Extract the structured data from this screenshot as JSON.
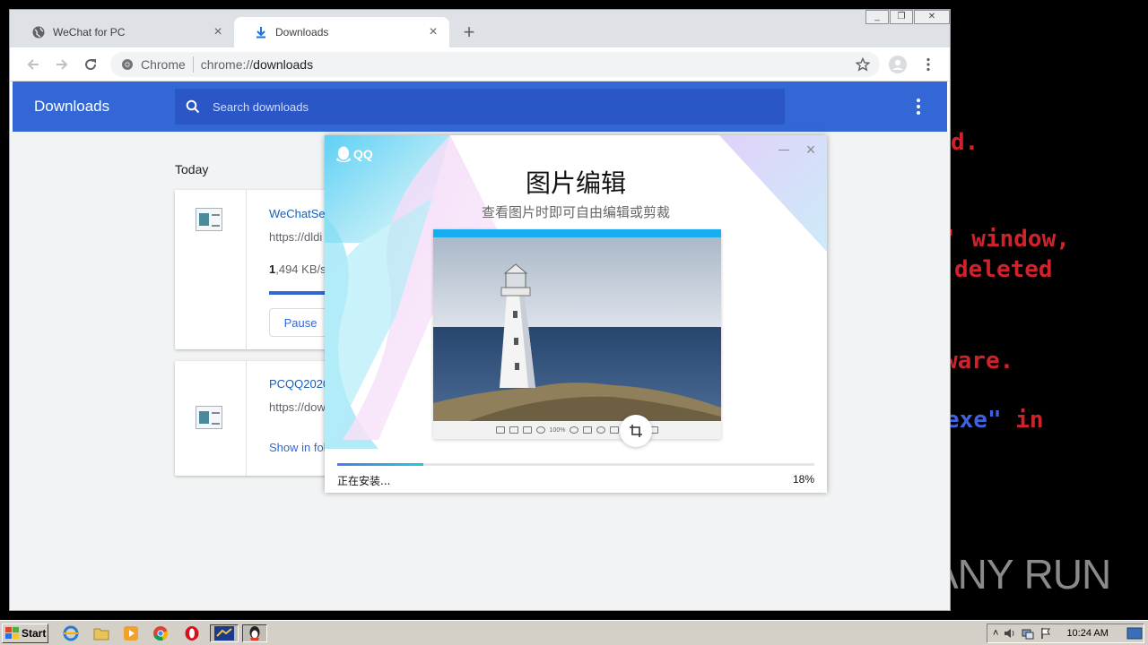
{
  "terminal": {
    "lines": [
      {
        "text": "d.",
        "color": "red"
      },
      {
        "text": "' window,",
        "color": "red"
      },
      {
        "text": "deleted",
        "color": "red"
      },
      {
        "text": "ware.",
        "color": "red"
      },
      {
        "text": "exe\" in",
        "color": "mixed"
      }
    ]
  },
  "watermark": {
    "text_left": "ANY",
    "text_right": "RUN"
  },
  "browser": {
    "tabs": [
      {
        "title": "WeChat for PC",
        "icon": "globe-icon"
      },
      {
        "title": "Downloads",
        "icon": "download-icon"
      }
    ],
    "omnibox": {
      "site": "Chrome",
      "scheme": "chrome://",
      "host": "downloads"
    }
  },
  "downloads": {
    "title": "Downloads",
    "search_placeholder": "Search downloads",
    "section": "Today",
    "items": [
      {
        "name": "WeChatSet",
        "url": "https://dldi",
        "speed_bold": "1",
        "speed_rest": ",494 KB/s",
        "progress": 0.25,
        "action": "Pause"
      },
      {
        "name": "PCQQ2020",
        "url": "https://dow",
        "link": "Show in fol"
      }
    ]
  },
  "installer": {
    "logo": "QQ",
    "title": "图片编辑",
    "subtitle": "查看图片时即可自由编辑或剪裁",
    "status": "正在安装...",
    "percent_label": "18%",
    "progress": 0.18,
    "preview_zoom": "100%"
  },
  "taskbar": {
    "start": "Start",
    "clock": "10:24 AM"
  },
  "colors": {
    "chrome_blue": "#3367d6",
    "terminal_red": "#d0222a",
    "terminal_blue": "#3f63e0"
  }
}
